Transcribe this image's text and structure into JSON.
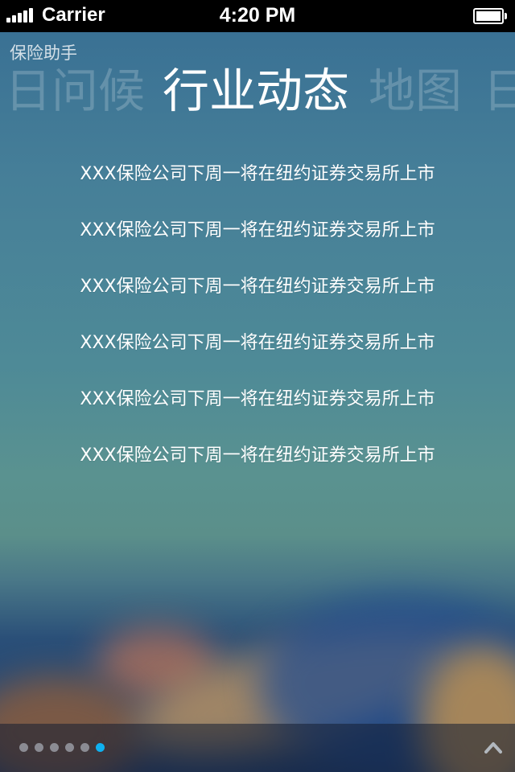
{
  "status_bar": {
    "carrier": "Carrier",
    "time": "4:20 PM",
    "signal_bars": 5,
    "battery_level": 1.0
  },
  "app": {
    "title": "保险助手"
  },
  "tabs": {
    "left": "日问候",
    "active": "行业动态",
    "right": "地图",
    "far_right": "日"
  },
  "news": [
    "XXX保险公司下周一将在纽约证券交易所上市",
    "XXX保险公司下周一将在纽约证券交易所上市",
    "XXX保险公司下周一将在纽约证券交易所上市",
    "XXX保险公司下周一将在纽约证券交易所上市",
    "XXX保险公司下周一将在纽约证券交易所上市",
    "XXX保险公司下周一将在纽约证券交易所上市"
  ],
  "pager": {
    "total": 6,
    "current": 6,
    "active_color": "#0fb1f0"
  },
  "icons": {
    "up": "chevron-up-icon"
  }
}
